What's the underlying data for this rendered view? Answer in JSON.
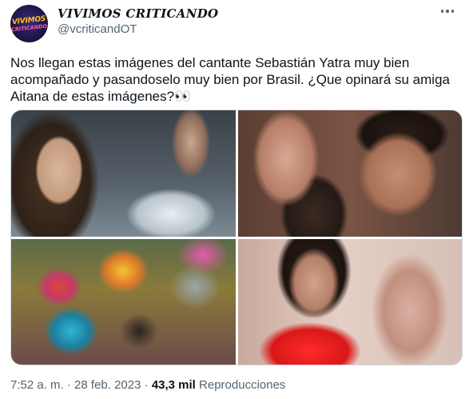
{
  "author": {
    "display_name": "VIVIMOS CRITICANDO",
    "handle": "@vcriticandOT",
    "avatar_text_1": "VIVIMOS",
    "avatar_text_2": "CRITICANDO"
  },
  "tweet": {
    "text": "Nos llegan estas imágenes del cantante Sebastián Yatra muy bien acompañado y pasandoselo muy bien por Brasil. ¿Que opinará su amiga Aitana de estas imágenes?👀",
    "time": "7:52 a. m.",
    "separator": "·",
    "date": "28 feb. 2023",
    "views_count": "43,3 mil",
    "views_label": "Reproducciones"
  },
  "media": {
    "photo_count": 4
  },
  "icons": {
    "more": "more-options-icon"
  },
  "colors": {
    "text_primary": "#0f1419",
    "text_secondary": "#536471",
    "border": "#cfd9de"
  }
}
